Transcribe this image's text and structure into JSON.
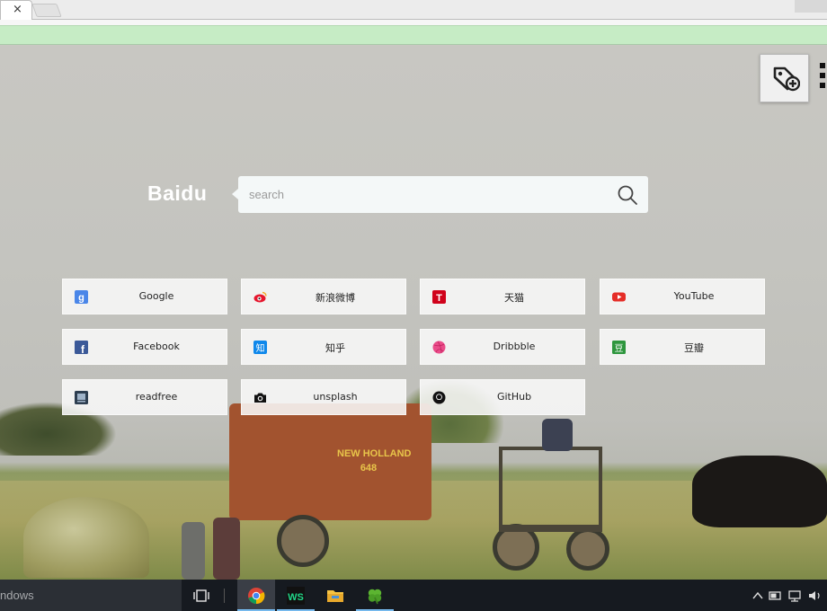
{
  "browser": {
    "tab_close_glyph": "×"
  },
  "newtab": {
    "brand": "Baidu",
    "search_placeholder": "search",
    "tiles": [
      {
        "label": "Google",
        "icon": "google-icon",
        "color": "#4a86e8"
      },
      {
        "label": "新浪微博",
        "icon": "weibo-icon",
        "color": "#e6162d"
      },
      {
        "label": "天猫",
        "icon": "tmall-icon",
        "color": "#d0021b"
      },
      {
        "label": "YouTube",
        "icon": "youtube-icon",
        "color": "#e52d27"
      },
      {
        "label": "Facebook",
        "icon": "facebook-icon",
        "color": "#3b5998"
      },
      {
        "label": "知乎",
        "icon": "zhihu-icon",
        "color": "#0f88eb"
      },
      {
        "label": "Dribbble",
        "icon": "dribbble-icon",
        "color": "#ea4c89"
      },
      {
        "label": "豆瓣",
        "icon": "douban-icon",
        "color": "#2e963d"
      },
      {
        "label": "readfree",
        "icon": "readfree-icon",
        "color": "#2d3e50"
      },
      {
        "label": "unsplash",
        "icon": "camera-icon",
        "color": "#111111"
      },
      {
        "label": "GitHub",
        "icon": "github-icon",
        "color": "#111111"
      }
    ],
    "tile_glyphs": {
      "google": "g",
      "tmall": "T",
      "facebook": "f",
      "zhihu": "知",
      "douban": "豆"
    },
    "machine_label": "NEW HOLLAND\n648"
  },
  "taskbar": {
    "search_text": "ndows",
    "apps": [
      "task-view-icon",
      "chrome-icon",
      "webstorm-icon",
      "file-explorer-icon",
      "clover-icon"
    ],
    "webstorm_glyph": "WS"
  },
  "colors": {
    "accent_blue": "#76b9ed",
    "notice_green": "#c6ecc5",
    "tile_bg": "#f8f8f8"
  }
}
